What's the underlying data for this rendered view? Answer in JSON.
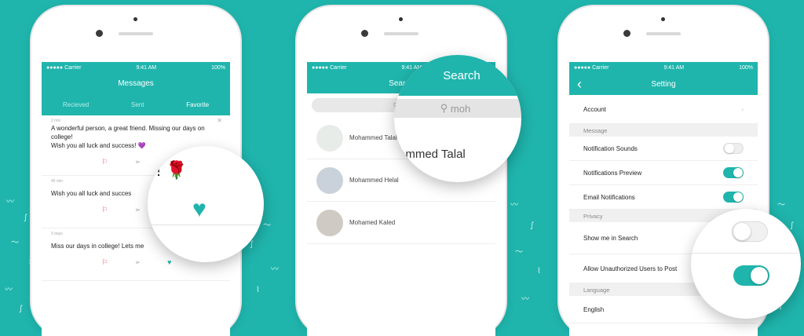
{
  "status": {
    "carrier": "●●●●● Carrier",
    "time": "9:41 AM",
    "battery": "100%"
  },
  "messages_screen": {
    "title": "Messages",
    "tabs": [
      "Recieved",
      "Sent",
      "Favorite"
    ],
    "messages": [
      {
        "time": "2 min",
        "text": "A wonderful person, a great friend. Missing our days on college!",
        "text2": "Wish you all luck and success! 💜"
      },
      {
        "time": "45 min",
        "text": "Wish you all luck and succes",
        "text2": ""
      },
      {
        "time": "3 days",
        "text": "Miss our days in college! Lets me",
        "text2": ""
      }
    ],
    "zoom_text": "s! 🌹"
  },
  "search_screen": {
    "title": "Search",
    "search_value": "moh",
    "contacts": [
      "Mohammed Talal",
      "Mohammed Helal",
      "Mohamed Kaled"
    ],
    "zoom_contact": "ammed Talal"
  },
  "settings_screen": {
    "title": "Setting",
    "back": "‹",
    "account": "Account",
    "section_message": "Message",
    "notification_sounds": "Notification Sounds",
    "notifications_preview": "Notifications Preview",
    "email_notifications": "Email Notifications",
    "section_privacy": "Privacy",
    "show_me_in_search": "Show me in Search",
    "allow_unauthorized": "Allow Unauthorized Users to Post",
    "section_language": "Language",
    "language_value": "English",
    "toggles": {
      "notification_sounds": false,
      "notifications_preview": true,
      "email_notifications": true,
      "show_me_in_search": false,
      "allow_unauthorized": true
    }
  },
  "colors": {
    "accent": "#1fb5ad"
  }
}
